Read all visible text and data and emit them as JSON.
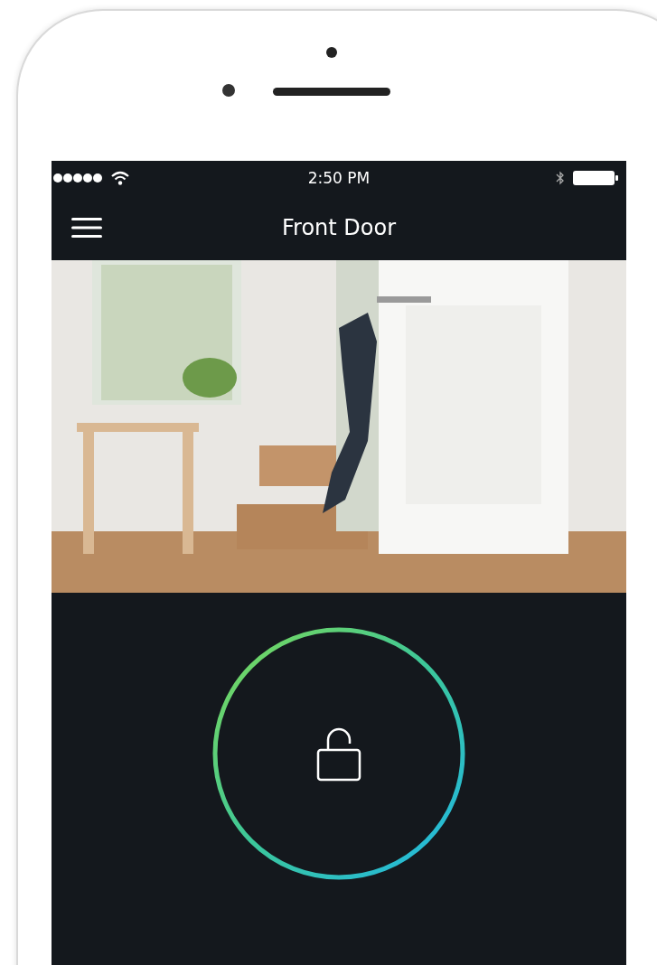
{
  "status_bar": {
    "time": "2:50 PM"
  },
  "nav_bar": {
    "title": "Front Door"
  },
  "lock": {
    "locked": false
  }
}
